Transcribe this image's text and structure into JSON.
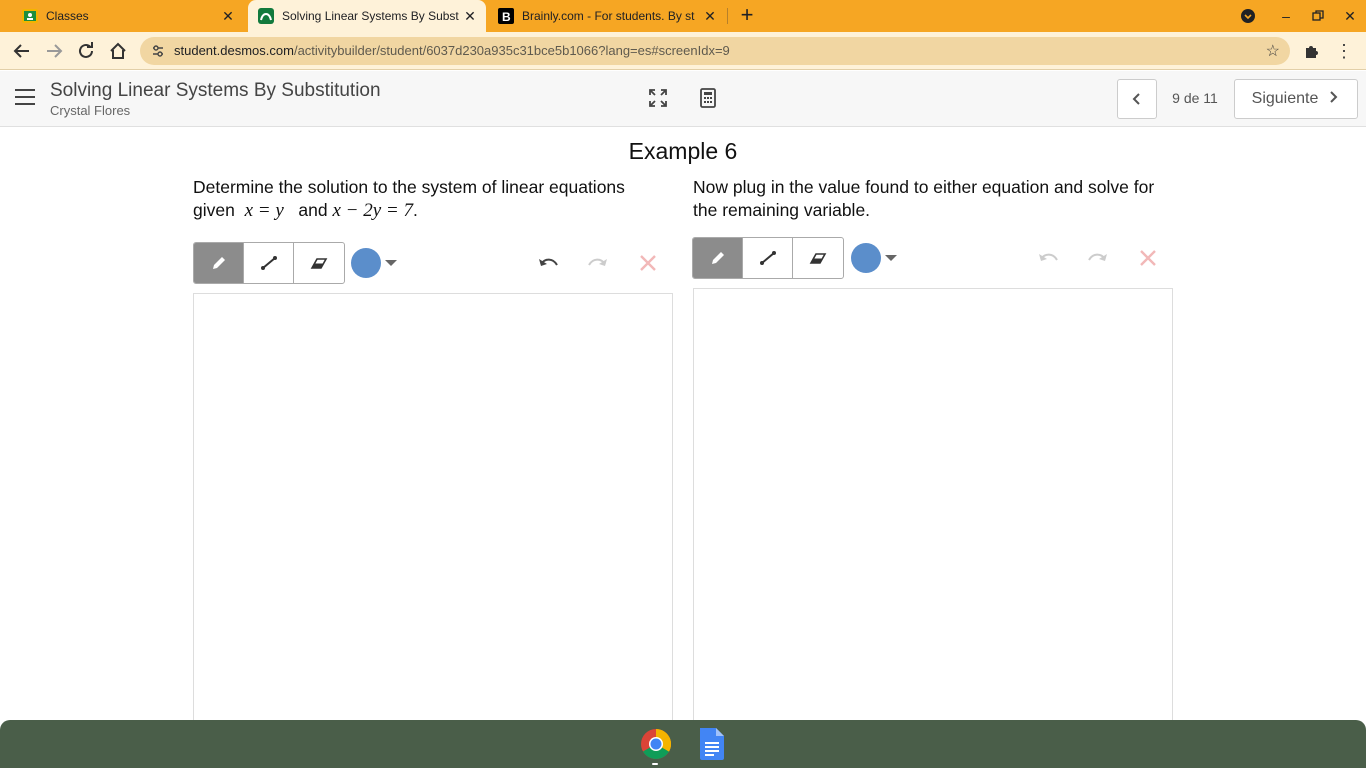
{
  "browser": {
    "tabs": [
      {
        "title": "Classes",
        "favicon": "google-classroom-icon",
        "active": false
      },
      {
        "title": "Solving Linear Systems By Subst",
        "favicon": "desmos-icon",
        "active": true
      },
      {
        "title": "Brainly.com - For students. By st",
        "favicon": "brainly-icon",
        "active": false
      }
    ],
    "url_domain": "student.desmos.com",
    "url_path": "/activitybuilder/student/6037d230a935c31bce5b1066?lang=es#screenIdx=9",
    "accent_color": "#f6a623"
  },
  "header": {
    "activity_title": "Solving Linear Systems By Substitution",
    "student_name": "Crystal Flores",
    "page_indicator": "9 de 11",
    "next_label": "Siguiente"
  },
  "screen": {
    "title": "Example 6",
    "left": {
      "prompt_line1": "Determine the solution to the system of linear equations",
      "prompt_given": "given",
      "eq1": "x = y",
      "prompt_and": "and",
      "eq2": "x − 2y = 7",
      "prompt_end": "."
    },
    "right": {
      "prompt": "Now plug in the value found to either equation and solve for the remaining variable."
    },
    "sketch_tools": [
      "pencil-tool",
      "line-tool",
      "eraser-tool"
    ],
    "pen_color": "#5b8ecb"
  },
  "shelf": {
    "apps": [
      "chrome-icon",
      "google-docs-icon"
    ],
    "background": "#4a5e49"
  }
}
